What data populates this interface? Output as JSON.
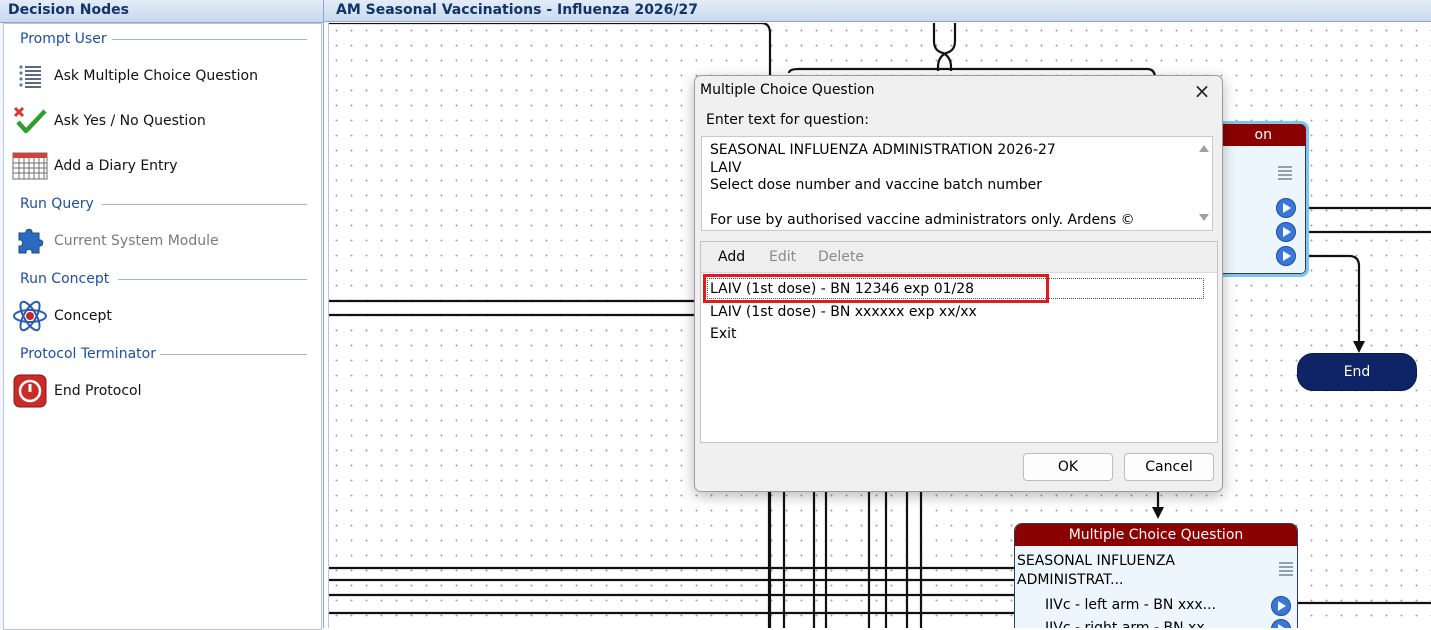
{
  "left_panel": {
    "title": "Decision Nodes",
    "groups": [
      {
        "title": "Prompt User",
        "items": [
          {
            "label": "Ask Multiple Choice Question",
            "icon": "list-icon"
          },
          {
            "label": "Ask Yes / No Question",
            "icon": "yes-no-check-icon"
          },
          {
            "label": "Add a Diary Entry",
            "icon": "calendar-icon"
          }
        ]
      },
      {
        "title": "Run Query",
        "items": [
          {
            "label": "Current System Module",
            "icon": "puzzle-icon",
            "disabled": true
          }
        ]
      },
      {
        "title": "Run Concept",
        "items": [
          {
            "label": "Concept",
            "icon": "atom-icon"
          }
        ]
      },
      {
        "title": "Protocol Terminator",
        "items": [
          {
            "label": "End Protocol",
            "icon": "power-icon"
          }
        ]
      }
    ]
  },
  "canvas": {
    "title": "AM Seasonal Vaccinations - Influenza 2026/27",
    "nodes": {
      "top_partial_title_tail": "on",
      "end_label": "End",
      "mcq_title": "Multiple Choice Question",
      "mcq_text_line1": "SEASONAL INFLUENZA",
      "mcq_text_line2": "ADMINISTRAT...",
      "mcq_answer1": "IIVc - left arm - BN xxx...",
      "mcq_answer2": "IIVc - right arm - BN xx..."
    }
  },
  "dialog": {
    "title": "Multiple Choice Question",
    "close_glyph": "×",
    "prompt_label": "Enter text for question:",
    "question_text": "SEASONAL INFLUENZA ADMINISTRATION 2026-27\nLAIV\nSelect dose number and vaccine batch number\n\nFor use by authorised vaccine administrators only. Ardens ©",
    "toolbar": {
      "add": "Add",
      "edit": "Edit",
      "delete": "Delete"
    },
    "answers": [
      "LAIV (1st dose) - BN 12346 exp 01/28",
      "LAIV (1st dose) - BN xxxxxx exp xx/xx",
      "Exit"
    ],
    "ok_label": "OK",
    "cancel_label": "Cancel"
  },
  "colors": {
    "node_title_red": "#8b0000",
    "end_node_navy": "#0f2466",
    "highlight_red": "#e01b1b",
    "header_blue": "#12346b",
    "group_title_blue": "#1c4ea3"
  }
}
